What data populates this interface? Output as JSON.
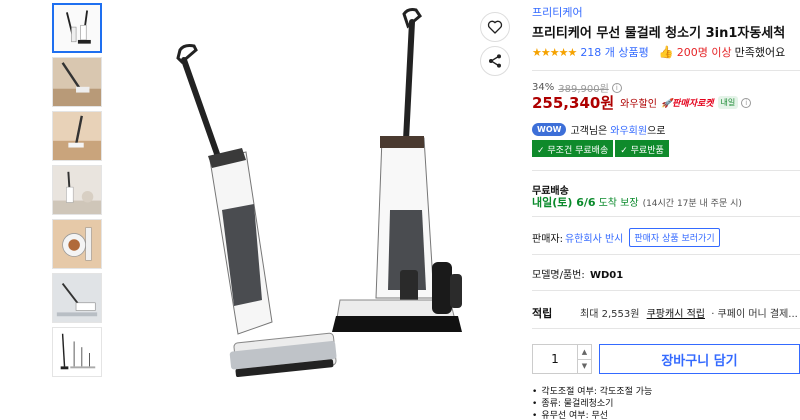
{
  "product": {
    "brand": "프리티케어",
    "title": "프리티케어 무선 물걸레 청소기 3in1자동세척",
    "rating": {
      "stars": "★★★★★",
      "review_count": "218 개 상품평"
    },
    "satisfaction": {
      "count": "200명 이상",
      "text": "만족했어요"
    }
  },
  "pricing": {
    "discount_rate": "34%",
    "original_price": "389,900원",
    "info_symbol": "i",
    "price": "255,340원",
    "wow_sale_label": "와우할인",
    "rocket_label": "🚀판매자로켓",
    "tomorrow_label": "내일"
  },
  "membership": {
    "wow_badge": "WOW",
    "text_before": "고객님은",
    "member_link": "와우회원",
    "text_after": "으로",
    "badges": [
      "✓ 무조건 무료배송",
      "✓ 무료반품"
    ]
  },
  "shipping": {
    "label": "무료배송",
    "date": "내일(토) 6/6",
    "date_tail": "도착 보장",
    "note": "(14시간 17분 내 주문 시)"
  },
  "seller": {
    "label": "판매자:",
    "name": "유한회사 반시",
    "button": "판매자 상품 보러가기"
  },
  "model": {
    "label": "모델명/품번:",
    "value": "WD01"
  },
  "points": {
    "label": "적립",
    "text_before": "최대 2,553원",
    "link": "쿠팡캐시 적립",
    "text_after": "· 쿠페이 머니 결제..."
  },
  "purchase": {
    "quantity": "1",
    "up_arrow": "▲",
    "down_arrow": "▼",
    "cart_label": "장바구니 담기"
  },
  "specs": [
    "각도조절 여부: 각도조절 가능",
    "종류: 물걸레청소기",
    "유무선 여부: 무선"
  ],
  "icons": {
    "wishlist": "heart-icon",
    "share": "share-icon"
  },
  "colors": {
    "accent": "#346aff",
    "price": "#ae0000",
    "green": "#0f8a2b",
    "star": "#f5a200"
  }
}
